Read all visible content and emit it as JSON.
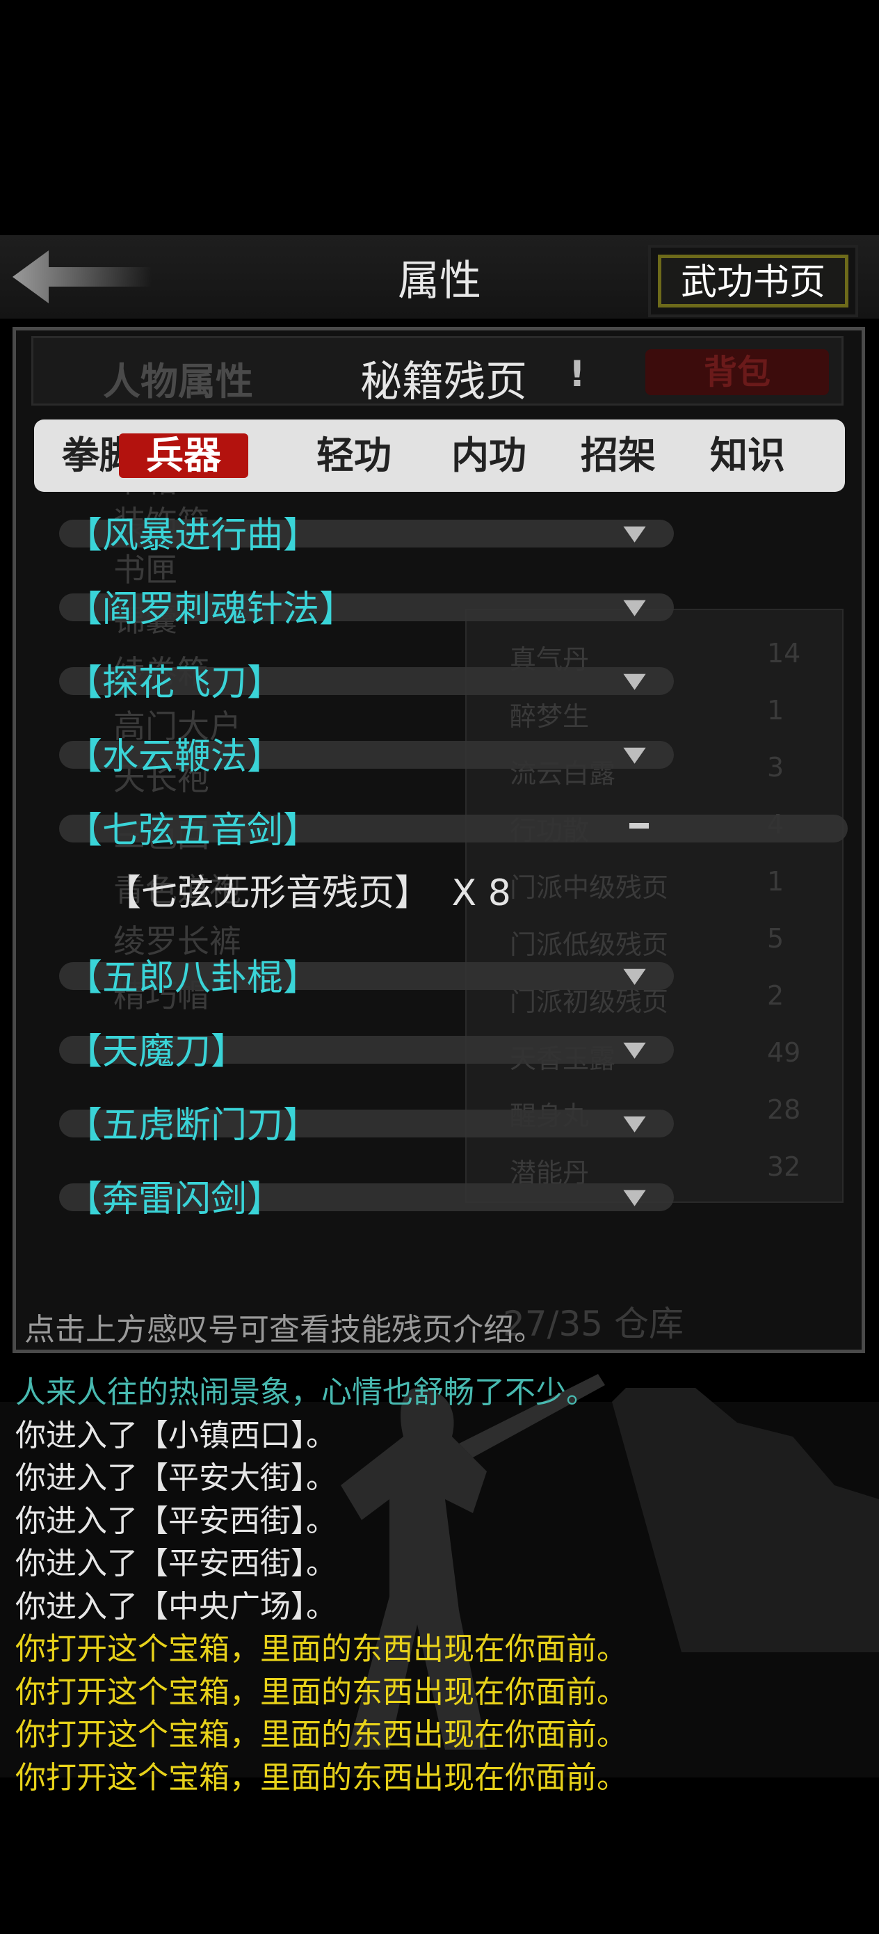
{
  "header": {
    "title": "属性",
    "gongfu_button": "武功书页"
  },
  "panel_header": {
    "left_label": "人物属性",
    "center_title": "秘籍残页",
    "info_mark": "!",
    "bag_button": "背包"
  },
  "tabs": [
    {
      "label": "拳脚",
      "active": false
    },
    {
      "label": "兵器",
      "active": true
    },
    {
      "label": "轻功",
      "active": false
    },
    {
      "label": "内功",
      "active": false
    },
    {
      "label": "招架",
      "active": false
    },
    {
      "label": "知识",
      "active": false
    }
  ],
  "sections": [
    {
      "label": "【风暴进行曲】",
      "expanded": false
    },
    {
      "label": "【阎罗刺魂针法】",
      "expanded": false
    },
    {
      "label": "【探花飞刀】",
      "expanded": false
    },
    {
      "label": "【水云鞭法】",
      "expanded": false
    },
    {
      "label": "【七弦五音剑】",
      "expanded": true
    },
    {
      "label": "【五郎八卦棍】",
      "expanded": false
    },
    {
      "label": "【天魔刀】",
      "expanded": false
    },
    {
      "label": "【五虎断门刀】",
      "expanded": false
    },
    {
      "label": "【奔雷闪剑】",
      "expanded": false
    }
  ],
  "expanded_item": {
    "name": "【七弦无形音残页】",
    "count": "X 8"
  },
  "hint": "点击上方感叹号可查看技能残页介绍。",
  "background_ghost": {
    "left_items": [
      "书箱",
      "装饰箱",
      "书匣",
      "锦囊",
      "绫卷箱",
      "高门大户",
      "天长袍",
      "三色回",
      "青色道袍",
      "绫罗长裤",
      "精巧帽"
    ],
    "right_items": [
      {
        "name": "真气丹",
        "qty": "14"
      },
      {
        "name": "醉梦生",
        "qty": "1"
      },
      {
        "name": "流云白露",
        "qty": "3"
      },
      {
        "name": "行功散",
        "qty": "4"
      },
      {
        "name": "门派中级残页",
        "qty": "1"
      },
      {
        "name": "门派低级残页",
        "qty": "5"
      },
      {
        "name": "门派初级残页",
        "qty": "2"
      },
      {
        "name": "天香玉露",
        "qty": "49"
      },
      {
        "name": "醒身丸",
        "qty": "28"
      },
      {
        "name": "潜能丹",
        "qty": "32"
      }
    ],
    "storage": "27/35 仓库"
  },
  "log": [
    {
      "text": "人来人往的热闹景象，心情也舒畅了不少。",
      "color": "#48b9b0"
    },
    {
      "text": "你进入了【小镇西口】。",
      "color": "#e6e6e6"
    },
    {
      "text": "你进入了【平安大街】。",
      "color": "#e6e6e6"
    },
    {
      "text": "你进入了【平安西街】。",
      "color": "#e6e6e6"
    },
    {
      "text": "你进入了【平安西街】。",
      "color": "#e6e6e6"
    },
    {
      "text": "你进入了【中央广场】。",
      "color": "#e6e6e6"
    },
    {
      "text": "你打开这个宝箱，里面的东西出现在你面前。",
      "color": "#e8d21a"
    },
    {
      "text": "你打开这个宝箱，里面的东西出现在你面前。",
      "color": "#e8d21a"
    },
    {
      "text": "你打开这个宝箱，里面的东西出现在你面前。",
      "color": "#e8d21a"
    },
    {
      "text": "你打开这个宝箱，里面的东西出现在你面前。",
      "color": "#e8d21a"
    }
  ],
  "colors": {
    "accent_red": "#b3120e",
    "section_cyan": "#3ad4d8",
    "log_yellow": "#e8d21a",
    "log_teal": "#48b9b0"
  }
}
